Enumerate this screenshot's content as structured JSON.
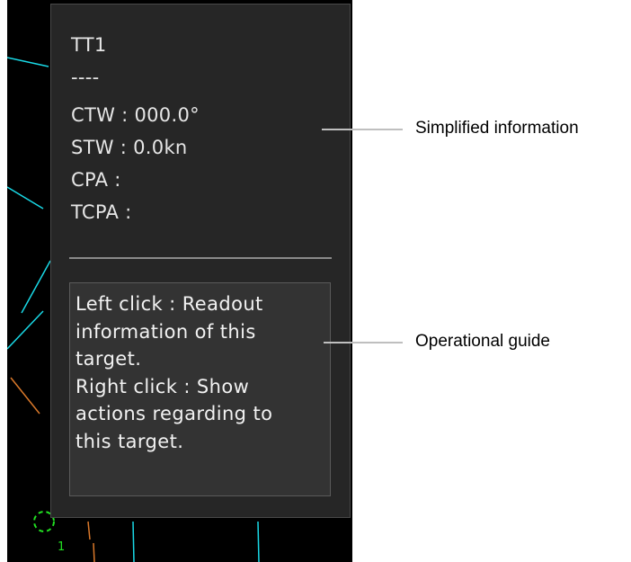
{
  "target_popup": {
    "title": "TT1",
    "subtitle": "----",
    "ctw": "CTW : 000.0°",
    "stw": "STW : 0.0kn",
    "cpa": "CPA :",
    "tcpa": "TCPA :",
    "guide_lines": [
      "Left click : Readout",
      "information of this",
      "target.",
      "Right click : Show",
      "actions regarding to",
      "this target."
    ]
  },
  "radar": {
    "target_number": "1",
    "colors": {
      "background": "#000000",
      "cyan_line": "#19d9e6",
      "orange_line": "#d9782a",
      "green_marker": "#22e022"
    }
  },
  "callouts": {
    "simplified": "Simplified information",
    "operational": "Operational guide"
  }
}
